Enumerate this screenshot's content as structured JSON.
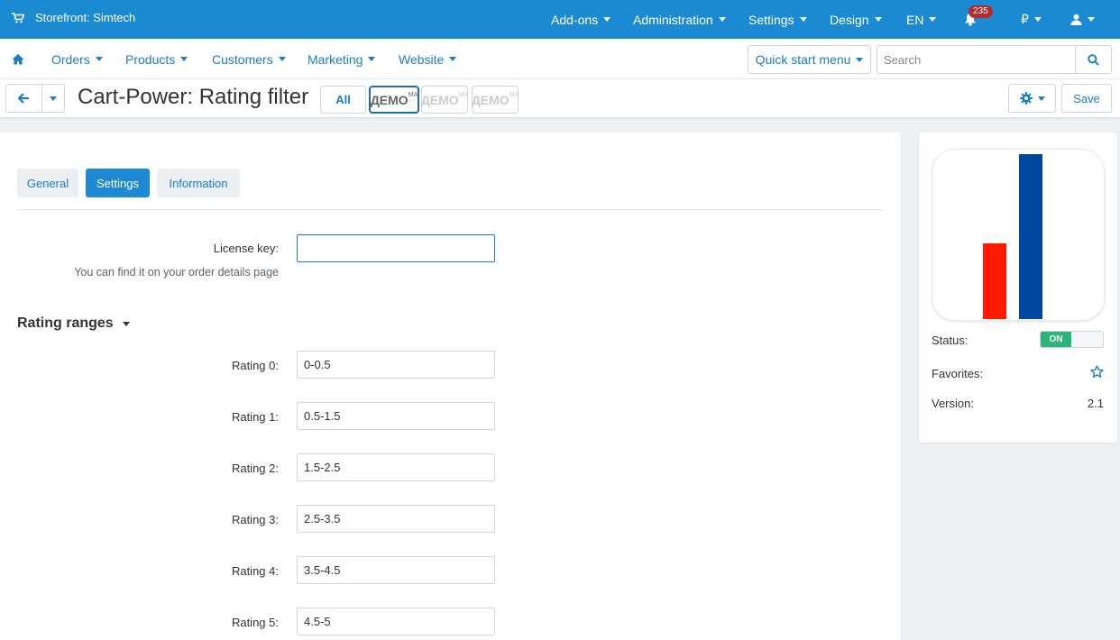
{
  "topbar": {
    "store_label": "Storefront: Simtech",
    "menus": [
      "Add-ons",
      "Administration",
      "Settings",
      "Design",
      "EN"
    ],
    "notification_count": "235",
    "currency": "₽",
    "background_color": "#1a8ad3"
  },
  "navbar": {
    "items": [
      "Orders",
      "Products",
      "Customers",
      "Marketing",
      "Website"
    ],
    "quick_start": "Quick start menu",
    "search_placeholder": "Search"
  },
  "titlebar": {
    "title": "Cart-Power: Rating filter",
    "filter_all": "All",
    "demo_text": "ДЕМО",
    "demo_sup": "МА",
    "save_label": "Save"
  },
  "tabs": {
    "general": "General",
    "settings": "Settings",
    "information": "Information"
  },
  "settings": {
    "license_label": "License key:",
    "license_value": "",
    "license_hint": "You can find it on your order details page",
    "section_title": "Rating ranges",
    "ratings": [
      {
        "label": "Rating 0:",
        "value": "0-0.5"
      },
      {
        "label": "Rating 1:",
        "value": "0.5-1.5"
      },
      {
        "label": "Rating 2:",
        "value": "1.5-2.5"
      },
      {
        "label": "Rating 3:",
        "value": "2.5-3.5"
      },
      {
        "label": "Rating 4:",
        "value": "3.5-4.5"
      },
      {
        "label": "Rating 5:",
        "value": "4.5-5"
      }
    ]
  },
  "sidebar": {
    "status_label": "Status:",
    "status_value": "ON",
    "favorites_label": "Favorites:",
    "version_label": "Version:",
    "version_value": "2.1",
    "logo_colors": {
      "red_bar": "#ff1a00",
      "blue_bar": "#0047a0"
    }
  },
  "colors": {
    "accent": "#1a7ec1",
    "active_tab": "#1f8ad3",
    "status_on": "#2db47a"
  }
}
